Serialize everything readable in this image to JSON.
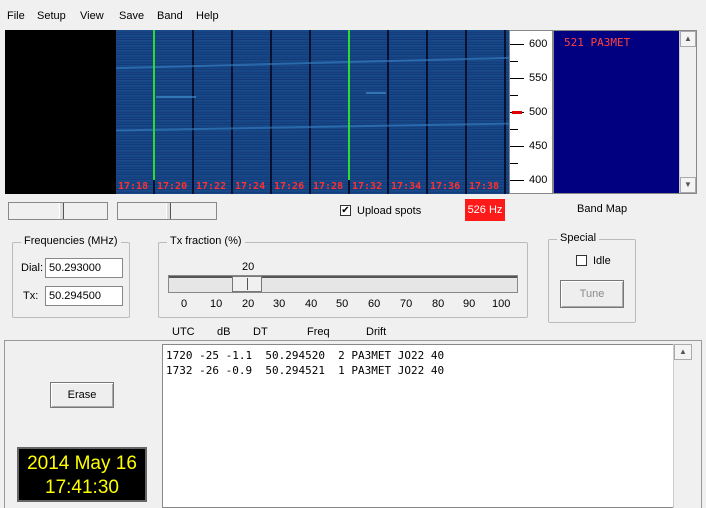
{
  "menu": [
    "File",
    "Setup",
    "View",
    "Save",
    "Band",
    "Help"
  ],
  "waterfall": {
    "time_labels": [
      "17:18",
      "17:20",
      "17:22",
      "17:24",
      "17:26",
      "17:28",
      "17:32",
      "17:34",
      "17:36",
      "17:38"
    ],
    "marker_color": "#2bdc2b",
    "label_color": "#ff3030"
  },
  "freq_scale": {
    "labels": [
      "600",
      "550",
      "500",
      "450",
      "400"
    ],
    "marker_hz": 500
  },
  "band_map": {
    "entry": "521  PA3MET",
    "label": "Band Map"
  },
  "upload_spots": {
    "label": "Upload spots",
    "checked": true
  },
  "selected_offset": "526 Hz",
  "frequencies": {
    "title": "Frequencies (MHz)",
    "dial_label": "Dial:",
    "dial_value": "50.293000",
    "tx_label": "Tx:",
    "tx_value": "50.294500"
  },
  "tx_fraction": {
    "title": "Tx fraction (%)",
    "value": 20,
    "ticks": [
      "0",
      "10",
      "20",
      "30",
      "40",
      "50",
      "60",
      "70",
      "80",
      "90",
      "100"
    ]
  },
  "special": {
    "title": "Special",
    "idle_label": "Idle",
    "idle_checked": false,
    "tune_label": "Tune"
  },
  "decode_headers": [
    "UTC",
    "dB",
    "DT",
    "Freq",
    "Drift"
  ],
  "decodes": [
    "1720 -25 -1.1  50.294520  2 PA3MET JO22 40",
    "1732 -26 -0.9  50.294521  1 PA3MET JO22 40"
  ],
  "erase_label": "Erase",
  "clock": {
    "date": "2014 May 16",
    "time": "17:41:30"
  }
}
